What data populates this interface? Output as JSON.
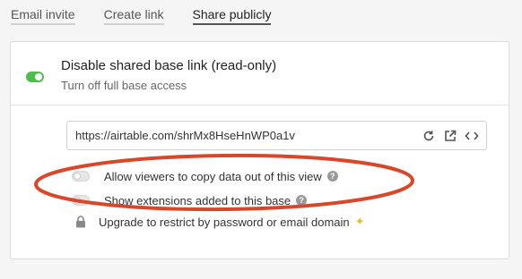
{
  "tabs": [
    {
      "label": "Email invite",
      "active": false
    },
    {
      "label": "Create link",
      "active": false
    },
    {
      "label": "Share publicly",
      "active": true
    }
  ],
  "share": {
    "toggle_on": true,
    "title": "Disable shared base link (read-only)",
    "subtitle": "Turn off full base access",
    "url": "https://airtable.com/shrMx8HseHnWP0a1v",
    "url_icons": [
      "refresh-icon",
      "open-external-icon",
      "embed-code-icon"
    ]
  },
  "options": [
    {
      "label": "Allow viewers to copy data out of this view",
      "toggle_on": false,
      "help": "?"
    },
    {
      "label": "Show extensions added to this base",
      "toggle_on": false,
      "help": "?"
    },
    {
      "label": "Upgrade to restrict by password or email domain",
      "icon": "lock-icon",
      "badge_icon": "sparkle-icon"
    }
  ],
  "annotation": {
    "color": "#d9472b",
    "shape": "ellipse"
  },
  "colors": {
    "toggle_on": "#4fbd4a",
    "accent_annotation": "#d9472b",
    "sparkle": "#e7c21a"
  }
}
